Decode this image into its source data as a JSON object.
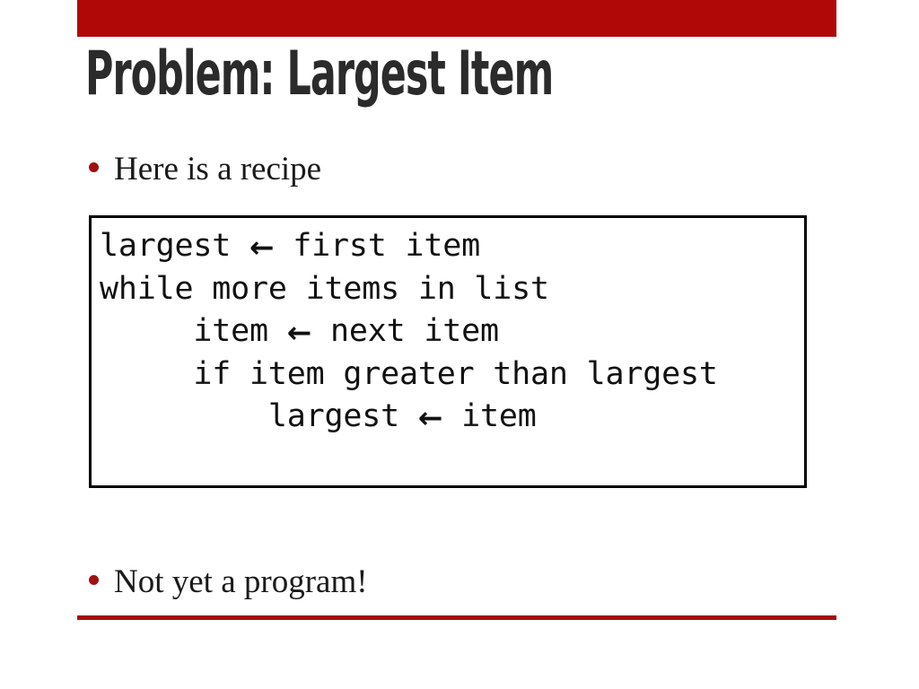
{
  "slide": {
    "title": "Problem: Largest Item",
    "bullets": [
      {
        "text": "Here is a recipe"
      },
      {
        "text": "Not yet a program!"
      }
    ],
    "code_block": {
      "lines": [
        {
          "indent": "",
          "before": "largest ",
          "arrow": "←",
          "after": " first item"
        },
        {
          "indent": "",
          "before": "while more items in list",
          "arrow": "",
          "after": ""
        },
        {
          "indent": "     ",
          "before": "item ",
          "arrow": "←",
          "after": " next item"
        },
        {
          "indent": "     ",
          "before": "if item greater than largest",
          "arrow": "",
          "after": ""
        },
        {
          "indent": "         ",
          "before": "largest ",
          "arrow": "←",
          "after": " item"
        }
      ]
    },
    "colors": {
      "header_bar": "#b00707",
      "footer_rule": "#a11212",
      "bullet_dot": "#a01010",
      "title_text": "#2b2b2b",
      "body_text": "#1a1a1a",
      "code_border": "#000000",
      "background": "#ffffff"
    }
  }
}
